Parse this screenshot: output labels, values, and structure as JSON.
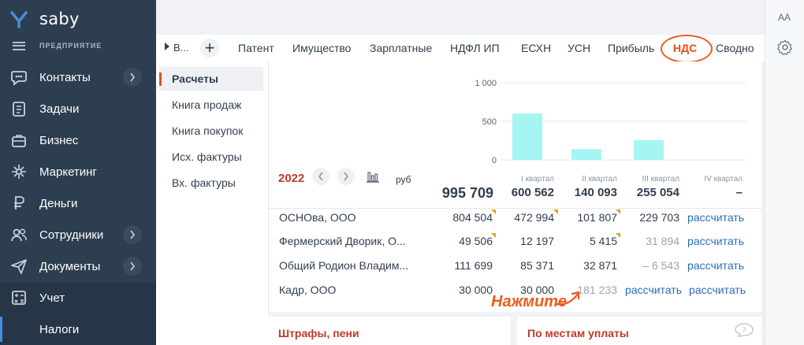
{
  "brand": {
    "name": "saby",
    "company": "ПРЕДПРИЯТИЕ"
  },
  "nav": [
    {
      "label": "Контакты",
      "icon": "chat-icon",
      "chevron": true
    },
    {
      "label": "Задачи",
      "icon": "task-icon",
      "chevron": false
    },
    {
      "label": "Бизнес",
      "icon": "briefcase-icon",
      "chevron": false
    },
    {
      "label": "Маркетинг",
      "icon": "sparkle-icon",
      "chevron": false
    },
    {
      "label": "Деньги",
      "icon": "ruble-icon",
      "chevron": false
    },
    {
      "label": "Сотрудники",
      "icon": "people-icon",
      "chevron": true
    },
    {
      "label": "Документы",
      "icon": "send-icon",
      "chevron": true
    },
    {
      "label": "Учет",
      "icon": "calculator-icon",
      "chevron": false
    }
  ],
  "nav_sub": {
    "label": "Налоги"
  },
  "rail": {
    "aa": "AA"
  },
  "tabs": {
    "crumb": "В...",
    "items": [
      "Патент",
      "Имущество",
      "Зарплатные",
      "НДФЛ ИП",
      "ЕСХН",
      "УСН",
      "Прибыль",
      "НДС",
      "Сводно"
    ],
    "active": "НДС"
  },
  "submenu": [
    "Расчеты",
    "Книга продаж",
    "Книга покупок",
    "Исх. фактуры",
    "Вх. фактуры"
  ],
  "chart_data": {
    "type": "bar",
    "categories": [
      "I квартал",
      "II квартал",
      "III квартал",
      "IV квартал"
    ],
    "values": [
      600562,
      140093,
      255054,
      0
    ],
    "ylim": [
      0,
      1000000
    ],
    "yticks": [
      "0",
      "500",
      "1 000"
    ],
    "bar_color": "#a5f6f3"
  },
  "period": {
    "year": "2022",
    "currency": "руб"
  },
  "totals": {
    "total": "995 709",
    "q": [
      "600 562",
      "140 093",
      "255 054",
      "–"
    ]
  },
  "rows": [
    {
      "name": "ОСНОва, ООО",
      "total": "804 504",
      "q": [
        "472 994",
        "101 807",
        "229 703",
        "рассчитать"
      ],
      "flags": [
        true,
        true,
        true,
        false
      ]
    },
    {
      "name": "Фермерский Дворик, О...",
      "total": "49 506",
      "q": [
        "12 197",
        "5 415",
        "31 894",
        "рассчитать"
      ],
      "flags": [
        true,
        false,
        true,
        false
      ]
    },
    {
      "name": "Общий Родион Владим...",
      "total": "111 699",
      "q": [
        "85 371",
        "32 871",
        "– 6 543",
        "рассчитать"
      ],
      "flags": [
        false,
        false,
        false,
        false
      ]
    },
    {
      "name": "Кадр, ООО",
      "total": "30 000",
      "q": [
        "30 000",
        "181 233",
        "рассчитать",
        "рассчитать"
      ],
      "flags": [
        false,
        false,
        false,
        false
      ]
    }
  ],
  "hint": "Нажмите",
  "cards": [
    "Штрафы, пени",
    "По местам уплаты"
  ],
  "colors": {
    "accent": "#e44f0f",
    "link": "#2a6ebb",
    "sidebar": "#2d3e50"
  }
}
